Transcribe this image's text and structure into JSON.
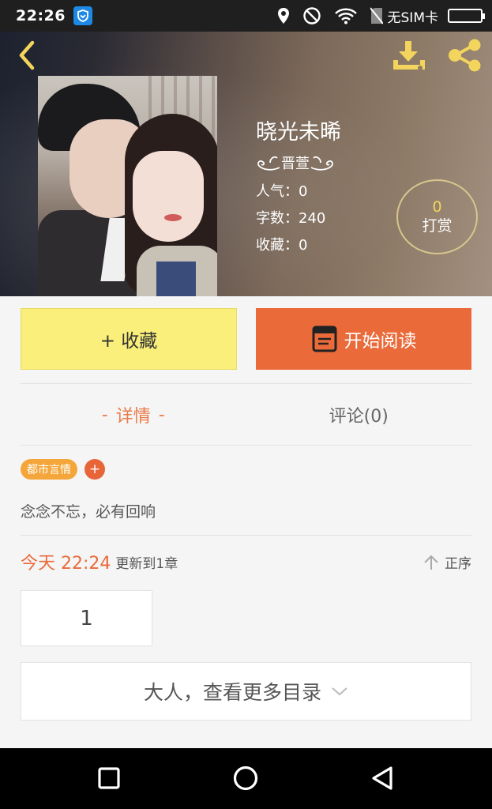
{
  "status_bar": {
    "time": "22:26",
    "sim": "无SIM卡"
  },
  "book": {
    "title": "晓光未晞",
    "author": "晋萱",
    "popularity": "人气：0",
    "word_count": "字数：240",
    "favorites": "收藏：0",
    "reward_count": "0",
    "reward_label": "打赏"
  },
  "actions": {
    "collect": "+ 收藏",
    "read": "开始阅读"
  },
  "tabs": {
    "details": "详情",
    "comments": "评论(0)"
  },
  "tags": [
    "都市言情"
  ],
  "tag_add": "+",
  "description": "念念不忘，必有回响",
  "update": {
    "date": "今天 22:24",
    "text": "更新到1章",
    "sort": "正序"
  },
  "page": "1",
  "more_catalog": "大人，查看更多目录",
  "colors": {
    "accent": "#ea6a3a",
    "collect_yellow": "#f9ef7a",
    "tag_orange": "#f4a63a"
  },
  "icons": [
    "back-icon",
    "download-icon",
    "share-icon",
    "book-icon",
    "arrow-up-icon",
    "chevron-down-icon",
    "nav-back-icon",
    "nav-home-icon",
    "nav-recents-icon"
  ]
}
